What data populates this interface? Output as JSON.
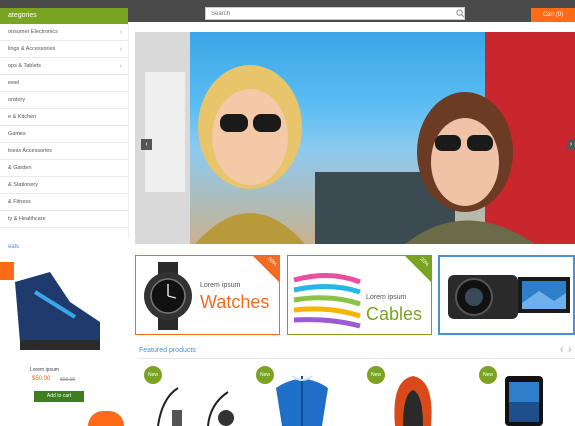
{
  "header": {
    "category_label": "ategories",
    "search_placeholder": "Search",
    "cart_label": "Cart (0)"
  },
  "sidebar": {
    "items": [
      "onsumer Electronics",
      "lings & Accessories",
      "ops & Tablets",
      "ewel",
      "oratory",
      "e & Kitchen",
      "Games",
      "tness Accessories",
      "& Garden",
      "& Stationery",
      "& Fitness",
      "ty & Healthcare"
    ]
  },
  "hero": {
    "prev_label": "‹",
    "next_label": "›"
  },
  "deal": {
    "title": "eals",
    "product_name": "Lorem ipsum",
    "price": "$50.00",
    "old_price": "$99.00",
    "button_label": "Add to cart"
  },
  "banners": [
    {
      "small": "Lorem ipsum",
      "big": "Watches",
      "corner": "50%",
      "color": "#f26b23"
    },
    {
      "small": "Lorem ipsum",
      "big": "Cables",
      "corner": "20%",
      "color": "#7aa321"
    },
    {
      "small": "",
      "big": "",
      "corner": "",
      "color": "#4a90d9"
    }
  ],
  "featured": {
    "title": "Featured products",
    "prev": "‹",
    "next": "›",
    "badges": [
      "New",
      "New",
      "New",
      "New"
    ]
  },
  "colors": {
    "accent_green": "#7aa321",
    "accent_orange": "#ff6a16",
    "link_blue": "#4a90d9"
  }
}
